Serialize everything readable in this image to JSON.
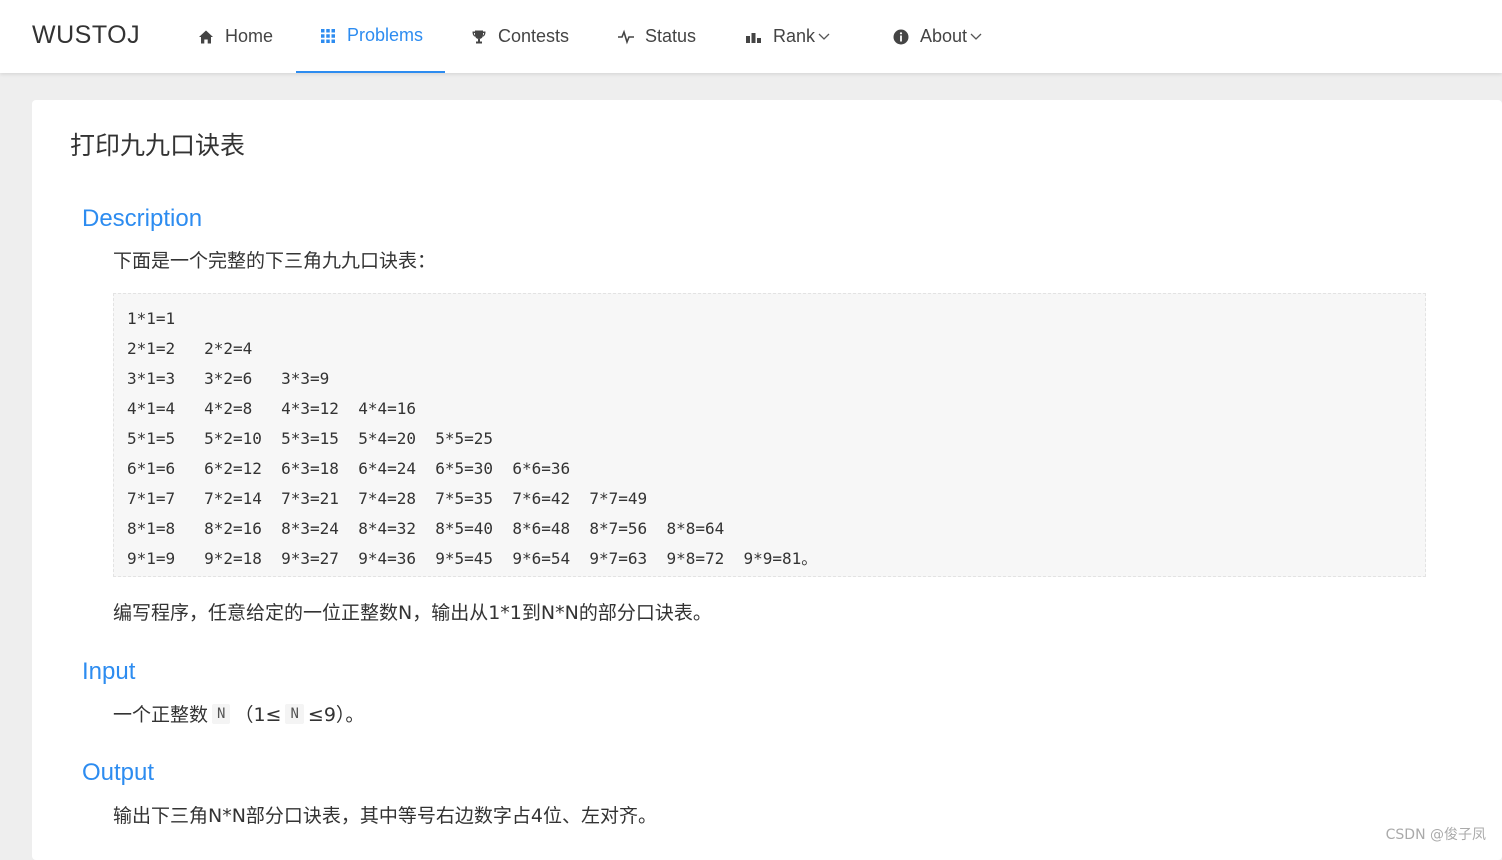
{
  "header": {
    "logo": "WUSTOJ",
    "nav": [
      {
        "label": "Home",
        "icon": "home-icon"
      },
      {
        "label": "Problems",
        "icon": "grid-icon",
        "active": true
      },
      {
        "label": "Contests",
        "icon": "trophy-icon"
      },
      {
        "label": "Status",
        "icon": "pulse-icon"
      },
      {
        "label": "Rank",
        "icon": "bar-chart-icon",
        "dropdown": true
      },
      {
        "label": "About",
        "icon": "info-icon",
        "dropdown": true
      }
    ],
    "accent_color": "#2d8cf0"
  },
  "problem": {
    "title": "打印九九口诀表",
    "description": {
      "heading": "Description",
      "intro": "下面是一个完整的下三角九九口诀表：",
      "code_lines": [
        "1*1=1",
        "2*1=2   2*2=4",
        "3*1=3   3*2=6   3*3=9",
        "4*1=4   4*2=8   4*3=12  4*4=16",
        "5*1=5   5*2=10  5*3=15  5*4=20  5*5=25",
        "6*1=6   6*2=12  6*3=18  6*4=24  6*5=30  6*6=36",
        "7*1=7   7*2=14  7*3=21  7*4=28  7*5=35  7*6=42  7*7=49",
        "8*1=8   8*2=16  8*3=24  8*4=32  8*5=40  8*6=48  8*7=56  8*8=64",
        "9*1=9   9*2=18  9*3=27  9*4=36  9*5=45  9*6=54  9*7=63  9*8=72  9*9=81。"
      ],
      "task": "编写程序，任意给定的一位正整数N，输出从1*1到N*N的部分口诀表。"
    },
    "input": {
      "heading": "Input",
      "text_before": "一个正整数",
      "code1": "N",
      "text_middle": "（1≤",
      "code2": "N",
      "text_after": "≤9）。"
    },
    "output": {
      "heading": "Output",
      "text": "输出下三角N*N部分口诀表，其中等号右边数字占4位、左对齐。"
    }
  },
  "watermark": "CSDN @俊子凤"
}
